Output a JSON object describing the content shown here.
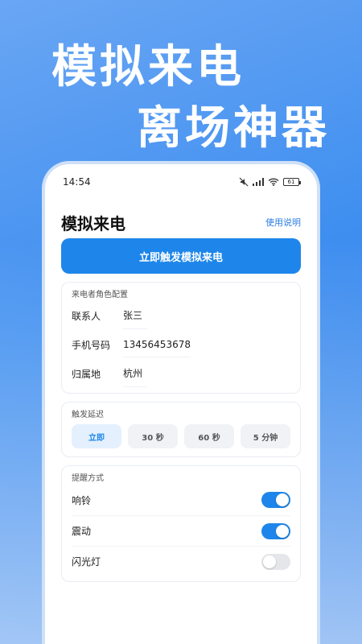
{
  "hero": {
    "line1": "模拟来电",
    "line2": "离场神器"
  },
  "status": {
    "time": "14:54",
    "battery": "61"
  },
  "header": {
    "title": "模拟来电",
    "help": "使用说明"
  },
  "trigger_button": "立即触发模拟来电",
  "caller": {
    "title": "来电者角色配置",
    "fields": [
      {
        "label": "联系人",
        "value": "张三"
      },
      {
        "label": "手机号码",
        "value": "13456453678"
      },
      {
        "label": "归属地",
        "value": "杭州"
      }
    ]
  },
  "delay": {
    "title": "触发延迟",
    "options": [
      "立即",
      "30 秒",
      "60 秒",
      "5 分钟"
    ],
    "selected": "立即"
  },
  "alerts": {
    "title": "提醒方式",
    "items": [
      {
        "label": "响铃",
        "on": true
      },
      {
        "label": "震动",
        "on": true
      },
      {
        "label": "闪光灯",
        "on": false
      }
    ]
  },
  "colors": {
    "accent": "#1e86ea",
    "bg_top": "#6aa6f4",
    "bg_bottom": "#2c7ce8"
  }
}
